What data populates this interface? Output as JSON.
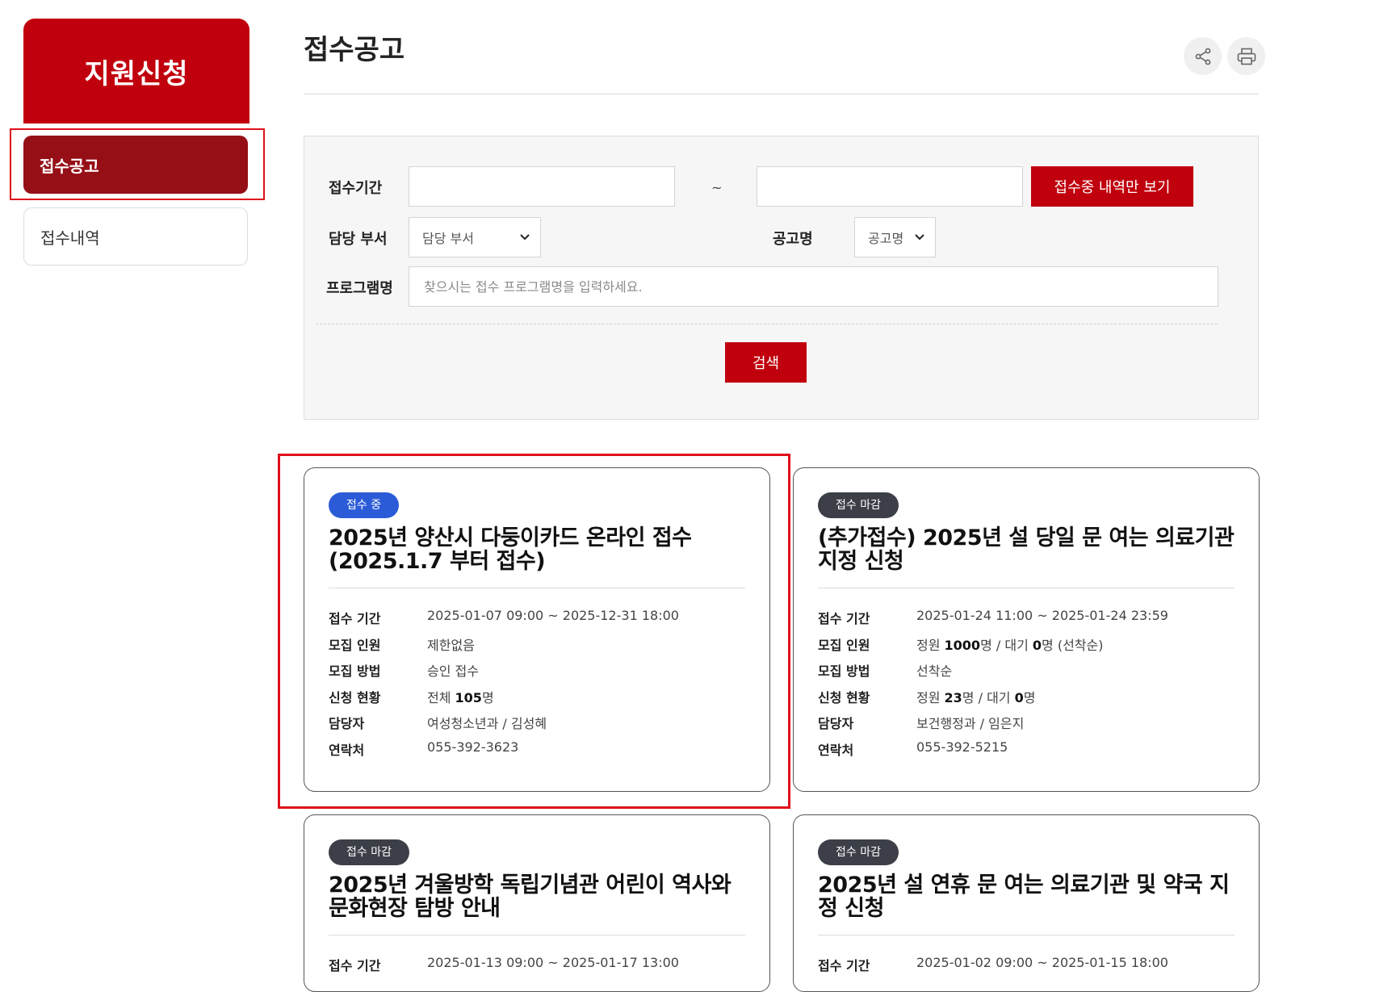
{
  "sidebar": {
    "title": "지원신청",
    "items": [
      {
        "label": "접수공고",
        "active": true
      },
      {
        "label": "접수내역",
        "active": false
      }
    ]
  },
  "header": {
    "title": "접수공고",
    "icons": [
      "share-icon",
      "print-icon"
    ]
  },
  "search": {
    "period_label": "접수기간",
    "tilde": "~",
    "only_open_button": "접수중 내역만 보기",
    "dept_label": "담당 부서",
    "dept_select": "담당 부서",
    "notice_label": "공고명",
    "notice_select": "공고명",
    "program_label": "프로그램명",
    "program_placeholder": "찾으시는 접수 프로그램명을 입력하세요.",
    "search_button": "검색"
  },
  "colors": {
    "brand": "#c1000d",
    "active_menu": "#960f16",
    "badge_open": "#2b5bd7",
    "badge_closed": "#3c3f47"
  },
  "cards": [
    {
      "status": "접수 중",
      "title": "2025년 양산시 다둥이카드 온라인 접수(2025.1.7 부터 접수)",
      "rows": [
        {
          "label": "접수 기간",
          "value": "2025-01-07 09:00 ~ 2025-12-31 18:00"
        },
        {
          "label": "모집 인원",
          "value": "제한없음"
        },
        {
          "label": "모집 방법",
          "value": "승인 접수"
        },
        {
          "label": "신청 현황",
          "pre": "전체 ",
          "bold": "105",
          "post": "명"
        },
        {
          "label": "담당자",
          "value": "여성청소년과 / 김성혜"
        },
        {
          "label": "연락처",
          "value": "055-392-3623"
        }
      ]
    },
    {
      "status": "접수 마감",
      "title": "(추가접수) 2025년 설 당일 문 여는 의료기관 지정 신청",
      "rows": [
        {
          "label": "접수 기간",
          "value": "2025-01-24 11:00 ~ 2025-01-24 23:59"
        },
        {
          "label": "모집 인원",
          "pre": "정원 ",
          "bold": "1000",
          "mid": "명 / 대기 ",
          "bold2": "0",
          "post": "명 (선착순)"
        },
        {
          "label": "모집 방법",
          "value": "선착순"
        },
        {
          "label": "신청 현황",
          "pre": "정원 ",
          "bold": "23",
          "mid": "명 / 대기 ",
          "bold2": "0",
          "post": "명"
        },
        {
          "label": "담당자",
          "value": "보건행정과 / 임은지"
        },
        {
          "label": "연락처",
          "value": "055-392-5215"
        }
      ]
    },
    {
      "status": "접수 마감",
      "title": "2025년 겨울방학 독립기념관 어린이 역사와 문화현장 탐방 안내",
      "rows": [
        {
          "label": "접수 기간",
          "value": "2025-01-13 09:00 ~ 2025-01-17 13:00"
        }
      ]
    },
    {
      "status": "접수 마감",
      "title": "2025년 설 연휴 문 여는 의료기관 및 약국 지정 신청",
      "rows": [
        {
          "label": "접수 기간",
          "value": "2025-01-02 09:00 ~ 2025-01-15 18:00"
        }
      ]
    }
  ]
}
